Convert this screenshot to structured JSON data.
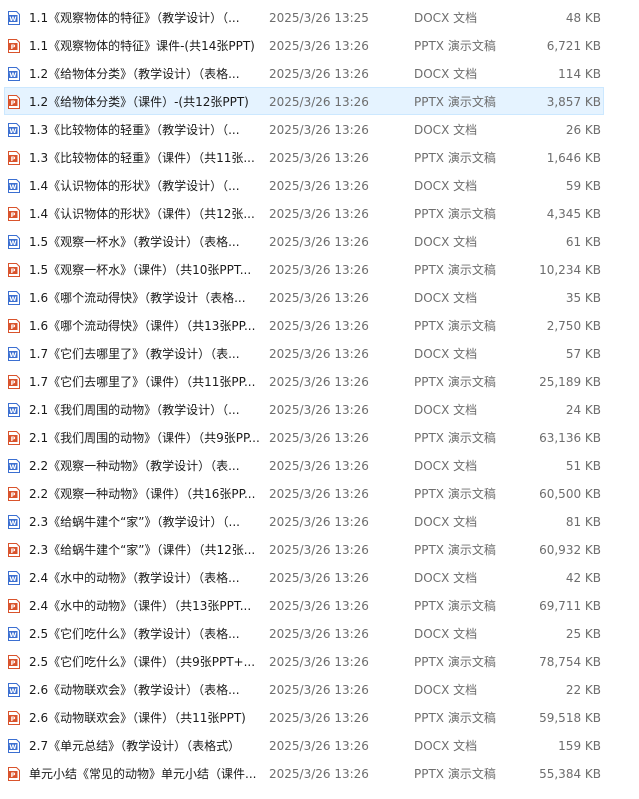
{
  "colors": {
    "docx_icon": "#3b6fd1",
    "pptx_icon": "#d9532c",
    "selected_row_bg": "#e5f3ff",
    "selected_row_border": "#cce8ff"
  },
  "files": [
    {
      "icon": "docx-icon",
      "name": "1.1《观察物体的特征》（教学设计）（...",
      "date": "2025/3/26 13:25",
      "type": "DOCX 文档",
      "size": "48 KB",
      "selected": false
    },
    {
      "icon": "pptx-icon",
      "name": "1.1《观察物体的特征》课件-(共14张PPT)",
      "date": "2025/3/26 13:26",
      "type": "PPTX 演示文稿",
      "size": "6,721 KB",
      "selected": false
    },
    {
      "icon": "docx-icon",
      "name": "1.2《给物体分类》（教学设计）（表格...",
      "date": "2025/3/26 13:26",
      "type": "DOCX 文档",
      "size": "114 KB",
      "selected": false
    },
    {
      "icon": "pptx-icon",
      "name": "1.2《给物体分类》（课件）-(共12张PPT)",
      "date": "2025/3/26 13:26",
      "type": "PPTX 演示文稿",
      "size": "3,857 KB",
      "selected": true
    },
    {
      "icon": "docx-icon",
      "name": "1.3《比较物体的轻重》（教学设计）（...",
      "date": "2025/3/26 13:26",
      "type": "DOCX 文档",
      "size": "26 KB",
      "selected": false
    },
    {
      "icon": "pptx-icon",
      "name": "1.3《比较物体的轻重》（课件）（共11张...",
      "date": "2025/3/26 13:26",
      "type": "PPTX 演示文稿",
      "size": "1,646 KB",
      "selected": false
    },
    {
      "icon": "docx-icon",
      "name": "1.4《认识物体的形状》（教学设计）（...",
      "date": "2025/3/26 13:26",
      "type": "DOCX 文档",
      "size": "59 KB",
      "selected": false
    },
    {
      "icon": "pptx-icon",
      "name": "1.4《认识物体的形状》（课件）（共12张...",
      "date": "2025/3/26 13:26",
      "type": "PPTX 演示文稿",
      "size": "4,345 KB",
      "selected": false
    },
    {
      "icon": "docx-icon",
      "name": "1.5《观察一杯水》（教学设计）（表格...",
      "date": "2025/3/26 13:26",
      "type": "DOCX 文档",
      "size": "61 KB",
      "selected": false
    },
    {
      "icon": "pptx-icon",
      "name": "1.5《观察一杯水》（课件）（共10张PPT...",
      "date": "2025/3/26 13:26",
      "type": "PPTX 演示文稿",
      "size": "10,234 KB",
      "selected": false
    },
    {
      "icon": "docx-icon",
      "name": "1.6《哪个流动得快》（教学设计（表格...",
      "date": "2025/3/26 13:26",
      "type": "DOCX 文档",
      "size": "35 KB",
      "selected": false
    },
    {
      "icon": "pptx-icon",
      "name": "1.6《哪个流动得快》（课件）（共13张PP...",
      "date": "2025/3/26 13:26",
      "type": "PPTX 演示文稿",
      "size": "2,750 KB",
      "selected": false
    },
    {
      "icon": "docx-icon",
      "name": "1.7《它们去哪里了》（教学设计）（表...",
      "date": "2025/3/26 13:26",
      "type": "DOCX 文档",
      "size": "57 KB",
      "selected": false
    },
    {
      "icon": "pptx-icon",
      "name": "1.7《它们去哪里了》（课件）（共11张PP...",
      "date": "2025/3/26 13:26",
      "type": "PPTX 演示文稿",
      "size": "25,189 KB",
      "selected": false
    },
    {
      "icon": "docx-icon",
      "name": "2.1《我们周围的动物》（教学设计）（...",
      "date": "2025/3/26 13:26",
      "type": "DOCX 文档",
      "size": "24 KB",
      "selected": false
    },
    {
      "icon": "pptx-icon",
      "name": "2.1《我们周围的动物》（课件）（共9张PP...",
      "date": "2025/3/26 13:26",
      "type": "PPTX 演示文稿",
      "size": "63,136 KB",
      "selected": false
    },
    {
      "icon": "docx-icon",
      "name": "2.2《观察一种动物》（教学设计）（表...",
      "date": "2025/3/26 13:26",
      "type": "DOCX 文档",
      "size": "51 KB",
      "selected": false
    },
    {
      "icon": "pptx-icon",
      "name": "2.2《观察一种动物》（课件）（共16张PP...",
      "date": "2025/3/26 13:26",
      "type": "PPTX 演示文稿",
      "size": "60,500 KB",
      "selected": false
    },
    {
      "icon": "docx-icon",
      "name": "2.3《给蜗牛建个“家”》（教学设计）（...",
      "date": "2025/3/26 13:26",
      "type": "DOCX 文档",
      "size": "81 KB",
      "selected": false
    },
    {
      "icon": "pptx-icon",
      "name": "2.3《给蜗牛建个“家”》（课件）（共12张...",
      "date": "2025/3/26 13:26",
      "type": "PPTX 演示文稿",
      "size": "60,932 KB",
      "selected": false
    },
    {
      "icon": "docx-icon",
      "name": "2.4《水中的动物》（教学设计）（表格...",
      "date": "2025/3/26 13:26",
      "type": "DOCX 文档",
      "size": "42 KB",
      "selected": false
    },
    {
      "icon": "pptx-icon",
      "name": "2.4《水中的动物》（课件）（共13张PPT...",
      "date": "2025/3/26 13:26",
      "type": "PPTX 演示文稿",
      "size": "69,711 KB",
      "selected": false
    },
    {
      "icon": "docx-icon",
      "name": "2.5《它们吃什么》（教学设计）（表格...",
      "date": "2025/3/26 13:26",
      "type": "DOCX 文档",
      "size": "25 KB",
      "selected": false
    },
    {
      "icon": "pptx-icon",
      "name": "2.5《它们吃什么》（课件）（共9张PPT+...",
      "date": "2025/3/26 13:26",
      "type": "PPTX 演示文稿",
      "size": "78,754 KB",
      "selected": false
    },
    {
      "icon": "docx-icon",
      "name": "2.6《动物联欢会》（教学设计）（表格...",
      "date": "2025/3/26 13:26",
      "type": "DOCX 文档",
      "size": "22 KB",
      "selected": false
    },
    {
      "icon": "pptx-icon",
      "name": "2.6《动物联欢会》（课件）（共11张PPT)",
      "date": "2025/3/26 13:26",
      "type": "PPTX 演示文稿",
      "size": "59,518 KB",
      "selected": false
    },
    {
      "icon": "docx-icon",
      "name": "2.7《单元总结》（教学设计）（表格式）",
      "date": "2025/3/26 13:26",
      "type": "DOCX 文档",
      "size": "159 KB",
      "selected": false
    },
    {
      "icon": "pptx-icon",
      "name": "单元小结《常见的动物》单元小结（课件...",
      "date": "2025/3/26 13:26",
      "type": "PPTX 演示文稿",
      "size": "55,384 KB",
      "selected": false
    }
  ]
}
